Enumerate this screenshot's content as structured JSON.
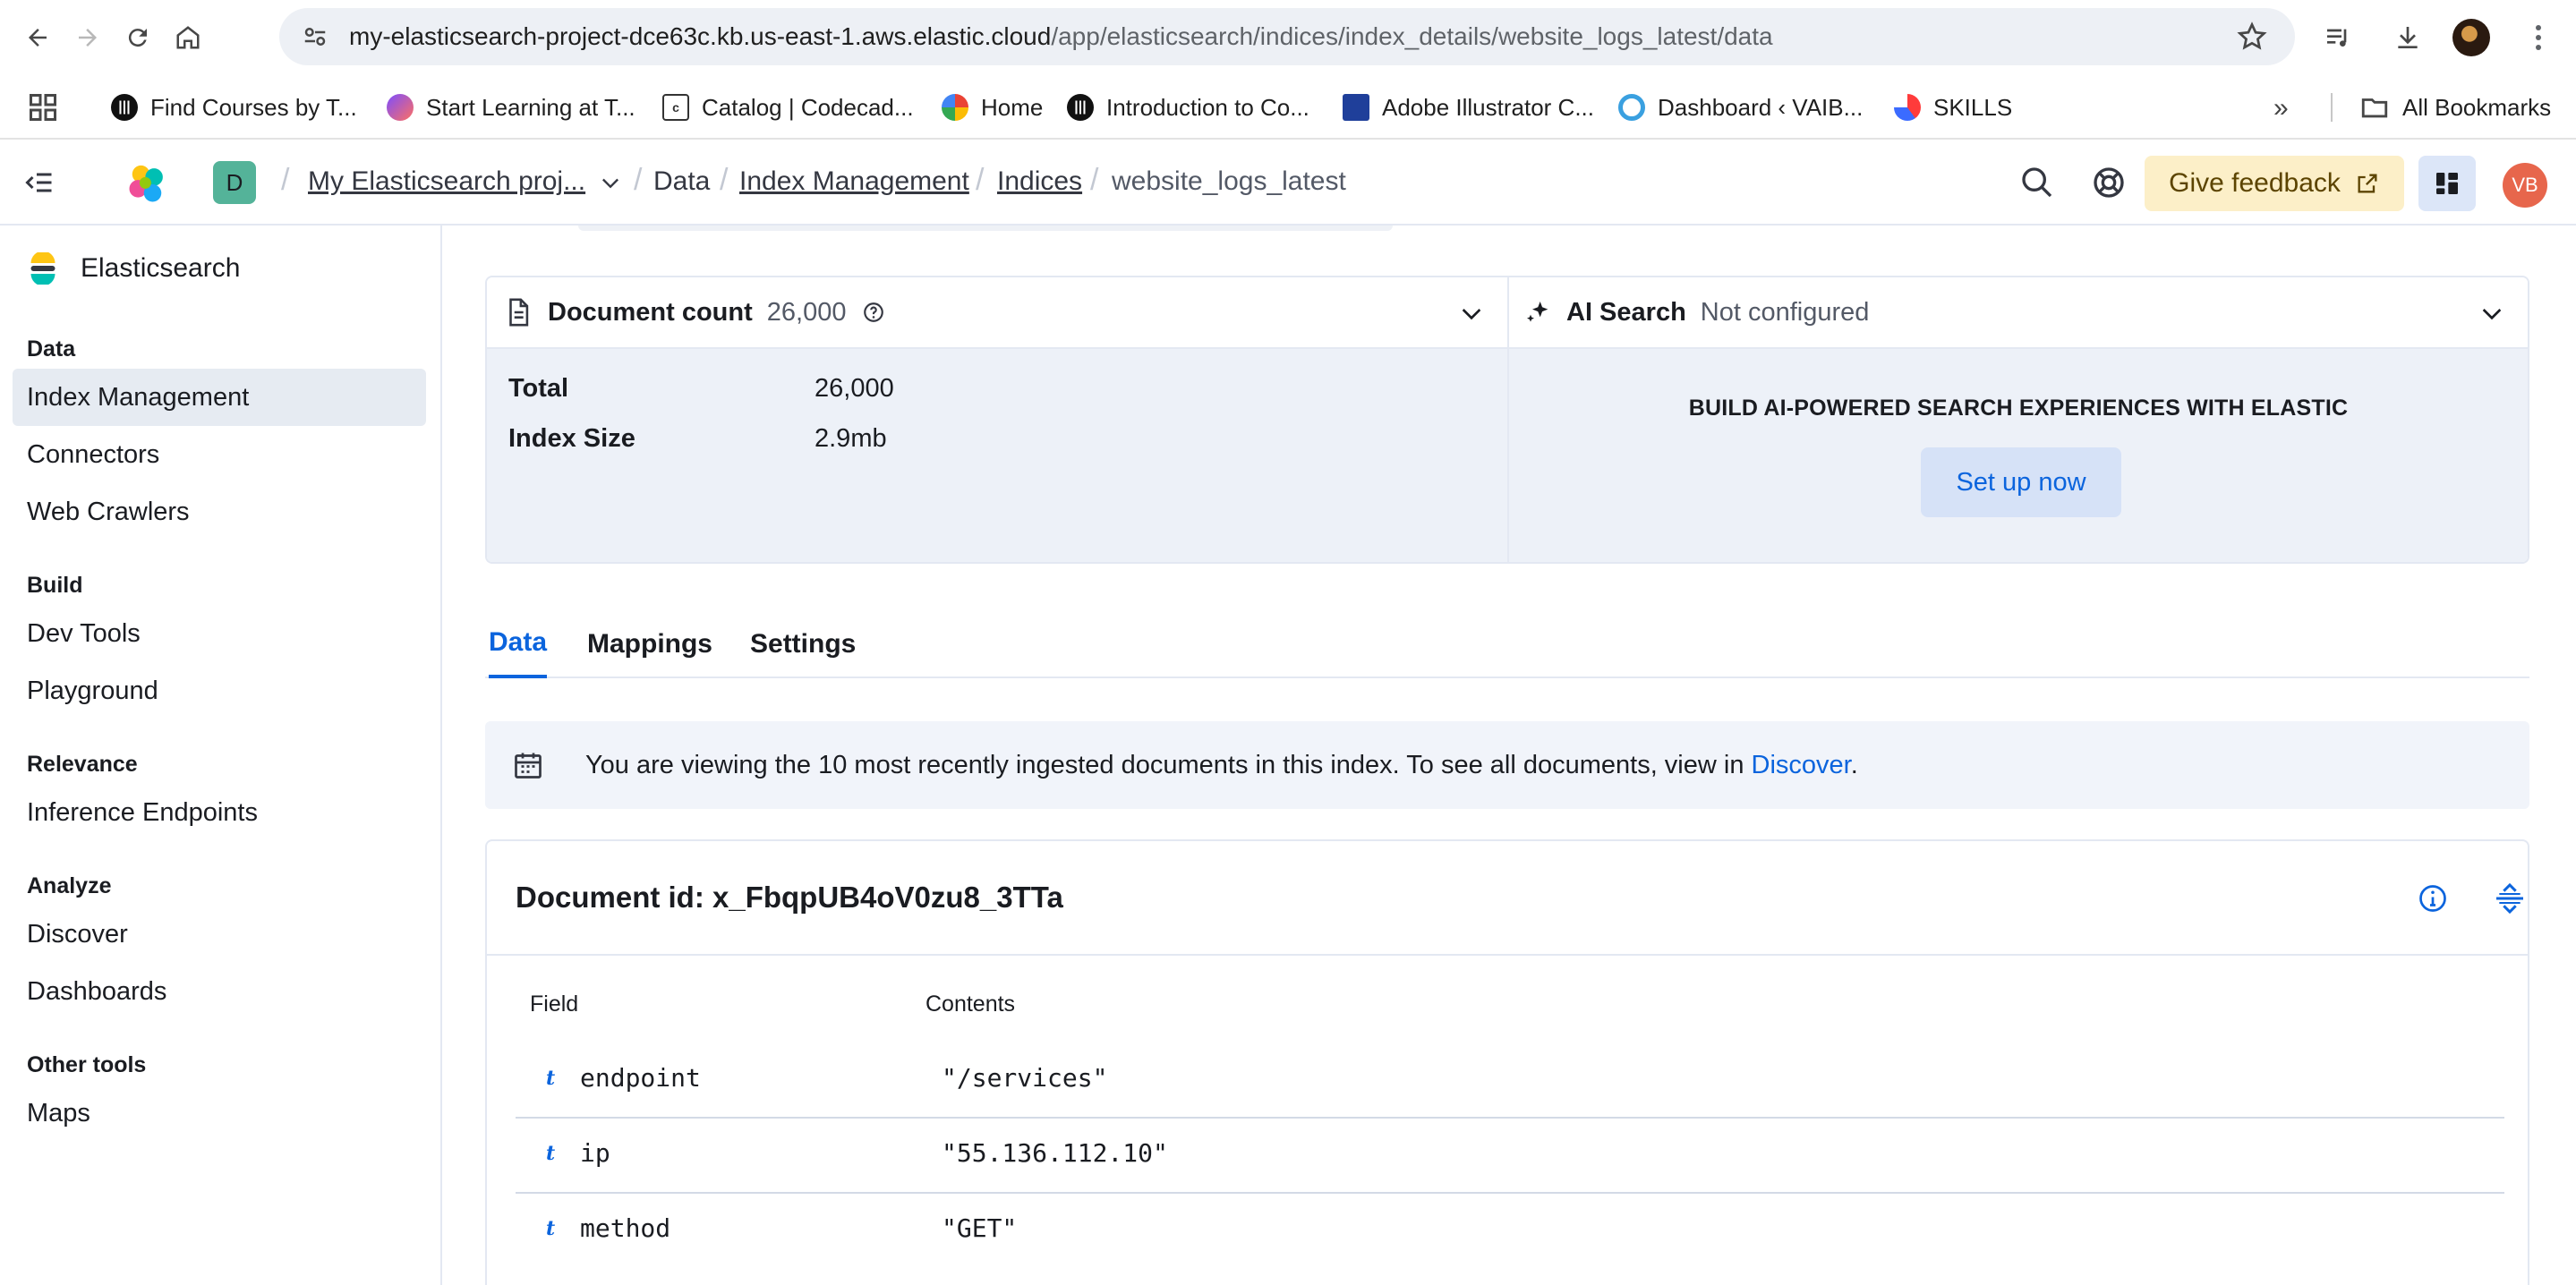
{
  "browser": {
    "url_host": "my-elasticsearch-project-dce63c.kb.us-east-1.aws.elastic.cloud",
    "url_path": "/app/elasticsearch/indices/index_details/website_logs_latest/data",
    "bookmarks": [
      {
        "label": "Find Courses by T...",
        "icon": "coursera-icon"
      },
      {
        "label": "Start Learning at T...",
        "icon": "treehouse-icon"
      },
      {
        "label": "Catalog | Codecad...",
        "icon": "codecademy-icon"
      },
      {
        "label": "Home",
        "icon": "google-icon"
      },
      {
        "label": "Introduction to Co...",
        "icon": "coursera-icon"
      },
      {
        "label": "Adobe Illustrator C...",
        "icon": "adobe-icon"
      },
      {
        "label": "Dashboard ‹ VAIB...",
        "icon": "wordpress-icon"
      },
      {
        "label": "SKILLS",
        "icon": "skills-icon"
      }
    ],
    "more_label": "»",
    "all_bookmarks_label": "All Bookmarks"
  },
  "header": {
    "space_initial": "D",
    "breadcrumbs": {
      "project": "My Elasticsearch proj...",
      "data": "Data",
      "index_management": "Index Management",
      "indices": "Indices",
      "current": "website_logs_latest"
    },
    "feedback_label": "Give feedback",
    "user_initials": "VB"
  },
  "sidenav": {
    "solution": "Elasticsearch",
    "groups": {
      "data": "Data",
      "build": "Build",
      "relevance": "Relevance",
      "analyze": "Analyze",
      "other": "Other tools"
    },
    "items": {
      "index_management": "Index Management",
      "connectors": "Connectors",
      "web_crawlers": "Web Crawlers",
      "dev_tools": "Dev Tools",
      "playground": "Playground",
      "inference_endpoints": "Inference Endpoints",
      "discover": "Discover",
      "dashboards": "Dashboards",
      "maps": "Maps"
    }
  },
  "doc_count_panel": {
    "title": "Document count",
    "value": "26,000",
    "total_label": "Total",
    "total_value": "26,000",
    "size_label": "Index Size",
    "size_value": "2.9mb"
  },
  "ai_panel": {
    "title": "AI Search",
    "status": "Not configured",
    "heading": "BUILD AI-POWERED SEARCH EXPERIENCES WITH ELASTIC",
    "button": "Set up now"
  },
  "tabs": {
    "data": "Data",
    "mappings": "Mappings",
    "settings": "Settings"
  },
  "callout": {
    "text": "You are viewing the 10 most recently ingested documents in this index. To see all documents, view in ",
    "link": "Discover",
    "suffix": "."
  },
  "document": {
    "id_label": "Document id: x_FbqpUB4oV0zu8_3TTa",
    "col_field": "Field",
    "col_contents": "Contents",
    "fields": [
      {
        "type": "t",
        "name": "endpoint",
        "value": "\"/services\""
      },
      {
        "type": "t",
        "name": "ip",
        "value": "\"55.136.112.10\""
      },
      {
        "type": "t",
        "name": "method",
        "value": "\"GET\""
      }
    ]
  },
  "colors": {
    "accent": "#0b64dd",
    "feedback_bg": "#fcefc8",
    "space_avatar": "#54b399",
    "user_avatar": "#e7664c"
  }
}
